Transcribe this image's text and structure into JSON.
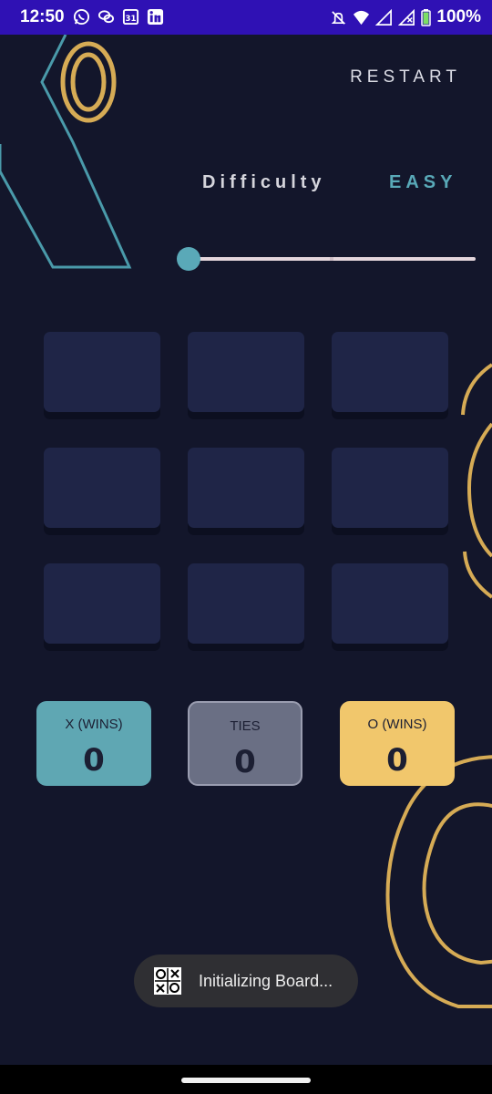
{
  "status_bar": {
    "time": "12:50",
    "battery": "100%",
    "left_icons": [
      "whatsapp-icon",
      "chat-icon",
      "calendar-icon",
      "linkedin-icon"
    ],
    "right_icons": [
      "mute-icon",
      "wifi-icon",
      "signal-icon",
      "signal-icon",
      "battery-icon"
    ]
  },
  "header": {
    "restart_label": "RESTART"
  },
  "difficulty": {
    "label": "Difficulty",
    "value": "EASY",
    "slider_level": 0
  },
  "board": {
    "cells": [
      "",
      "",
      "",
      "",
      "",
      "",
      "",
      "",
      ""
    ]
  },
  "scores": {
    "x": {
      "label": "X (WINS)",
      "value": "0"
    },
    "ties": {
      "label": "TIES",
      "value": "0"
    },
    "o": {
      "label": "O (WINS)",
      "value": "0"
    }
  },
  "toast": {
    "text": "Initializing Board...",
    "icon": "tic-tac-toe-icon"
  },
  "colors": {
    "background": "#13162b",
    "status_bar": "#2f11b4",
    "accent_teal": "#5aa9b8",
    "accent_gold": "#f1c76c",
    "cell": "#1f2547"
  }
}
